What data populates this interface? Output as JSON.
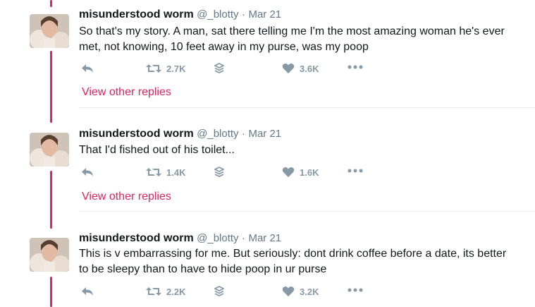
{
  "colors": {
    "accent": "#e0245e",
    "muted": "#8899a6",
    "text": "#14171a"
  },
  "tweets": [
    {
      "name": "misunderstood worm",
      "handle": "@_blotty",
      "dot": "·",
      "time": "Mar 21",
      "text": "So that's my story. A man, sat there telling me I'm the most amazing woman he's ever met, not knowing, 10 feet away in my purse, was my poop",
      "retweets": "2.7K",
      "likes": "3.6K",
      "view_replies": "View other replies"
    },
    {
      "name": "misunderstood worm",
      "handle": "@_blotty",
      "dot": "·",
      "time": "Mar 21",
      "text": "That I'd fished out of his toilet...",
      "retweets": "1.4K",
      "likes": "1.6K",
      "view_replies": "View other replies"
    },
    {
      "name": "misunderstood worm",
      "handle": "@_blotty",
      "dot": "·",
      "time": "Mar 21",
      "text": "This is v embarrassing for me. But seriously: dont drink coffee before a date, its better to be sleepy than to have to hide poop in ur purse",
      "retweets": "2.2K",
      "likes": "3.2K"
    }
  ],
  "icons": [
    "reply-icon",
    "retweet-icon",
    "stack-icon",
    "heart-icon",
    "more-icon"
  ]
}
